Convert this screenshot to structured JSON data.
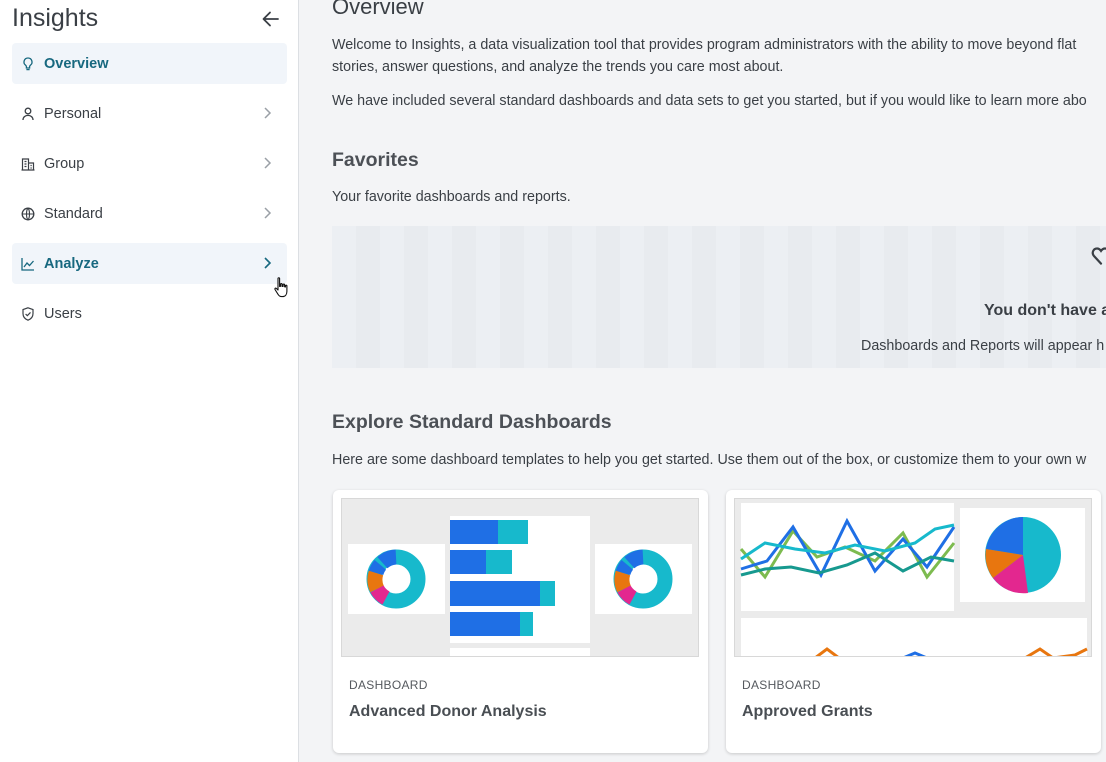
{
  "sidebar": {
    "title": "Insights",
    "items": [
      {
        "label": "Overview",
        "icon": "lightbulb-icon"
      },
      {
        "label": "Personal",
        "icon": "person-icon"
      },
      {
        "label": "Group",
        "icon": "building-icon"
      },
      {
        "label": "Standard",
        "icon": "globe-icon"
      },
      {
        "label": "Analyze",
        "icon": "line-chart-icon"
      },
      {
        "label": "Users",
        "icon": "shield-icon"
      }
    ]
  },
  "main": {
    "title": "Overview",
    "intro_line1": "Welcome to Insights, a data visualization tool that provides program administrators with the ability to move beyond flat",
    "intro_line2": "stories, answer questions, and analyze the trends you care most about.",
    "intro_line3": "We have included several standard dashboards and data sets to get you started, but if you would like to learn more abo",
    "favorites": {
      "heading": "Favorites",
      "description": "Your favorite dashboards and reports.",
      "empty_title": "You don't have a",
      "empty_text": "Dashboards and Reports will appear h"
    },
    "explore": {
      "heading": "Explore Standard Dashboards",
      "description": "Here are some dashboard templates to help you get started. Use them out of the box, or customize them to your own w",
      "cards": [
        {
          "kind": "DASHBOARD",
          "title": "Advanced Donor Analysis"
        },
        {
          "kind": "DASHBOARD",
          "title": "Approved Grants"
        }
      ]
    }
  },
  "colors": {
    "active_text": "#17687f",
    "active_bg": "#f1f5fa",
    "blue": "#1f6fe5",
    "teal": "#17b9cc",
    "orange": "#e8760f",
    "magenta": "#e3278f",
    "green": "#7dbb4f"
  }
}
